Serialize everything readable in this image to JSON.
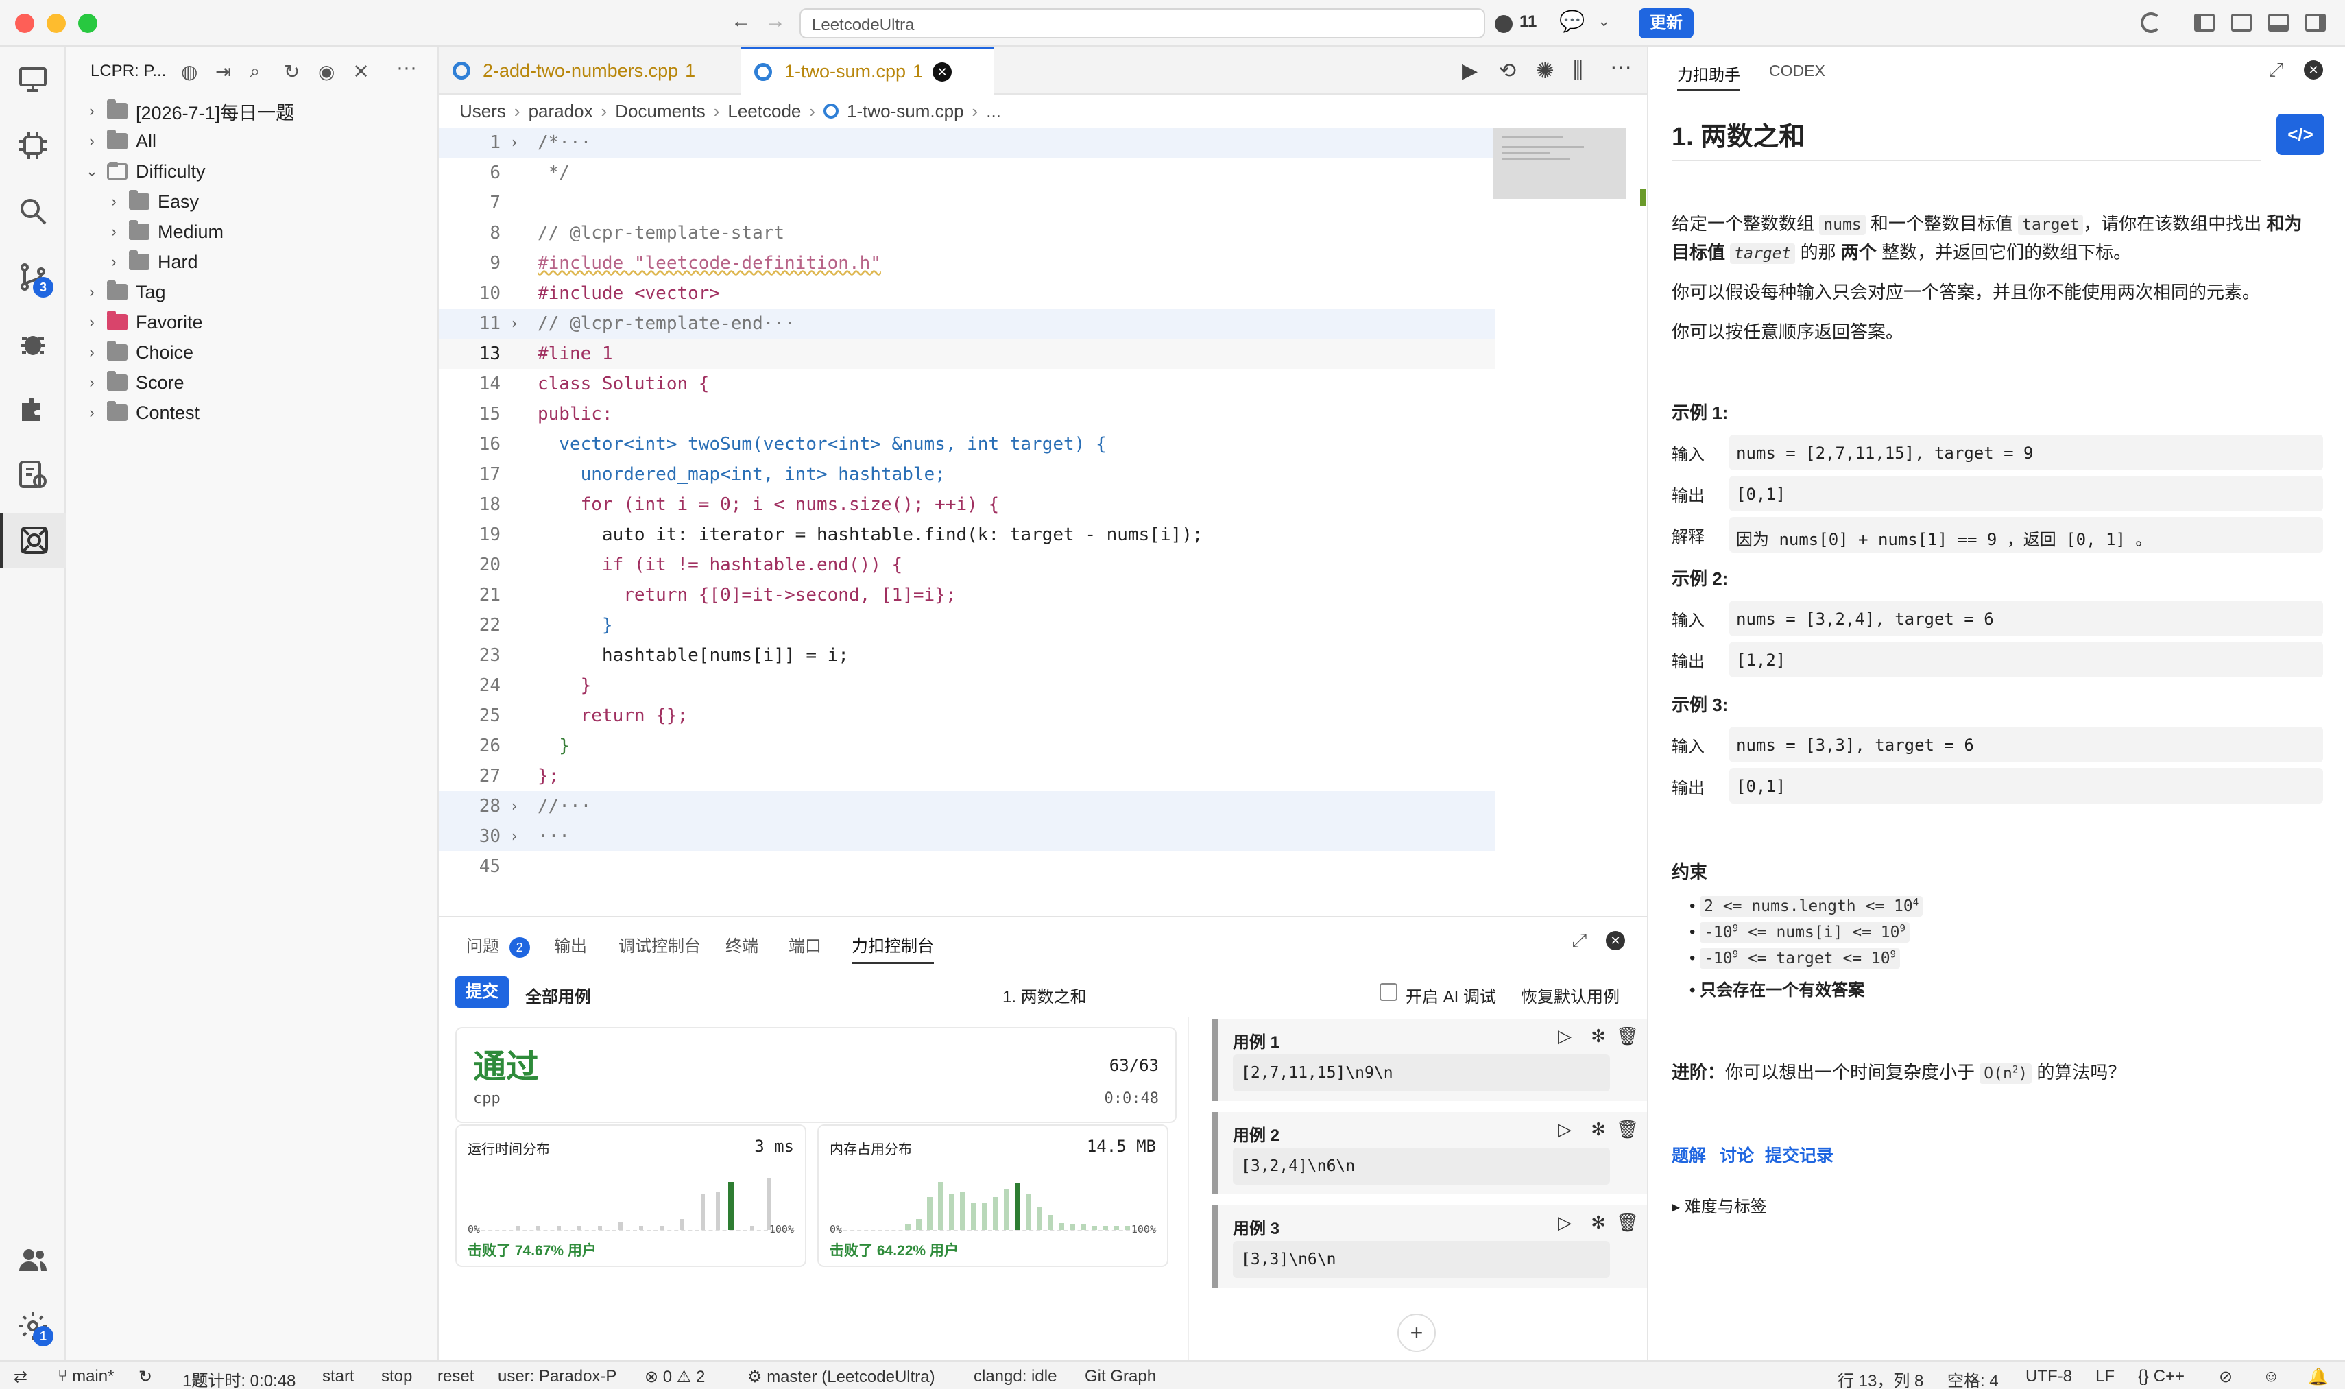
{
  "titlebar": {
    "search_text": "LeetcodeUltra",
    "pr_count": "11",
    "update_label": "更新"
  },
  "activity": {
    "source_badge": "3",
    "settings_badge": "1"
  },
  "explorer": {
    "title": "LCPR: P...",
    "items": [
      {
        "label": "[2026-7-1]每日一题"
      },
      {
        "label": "All"
      },
      {
        "label": "Difficulty"
      },
      {
        "label": "Easy"
      },
      {
        "label": "Medium"
      },
      {
        "label": "Hard"
      },
      {
        "label": "Tag"
      },
      {
        "label": "Favorite"
      },
      {
        "label": "Choice"
      },
      {
        "label": "Score"
      },
      {
        "label": "Contest"
      }
    ]
  },
  "editor": {
    "tabs": [
      {
        "label": "2-add-two-numbers.cpp",
        "badge": "1"
      },
      {
        "label": "1-two-sum.cpp",
        "badge": "1"
      }
    ],
    "breadcrumb": [
      "Users",
      "paradox",
      "Documents",
      "Leetcode",
      "1-two-sum.cpp",
      "..."
    ],
    "lines": [
      {
        "n": "1",
        "t": "/*···"
      },
      {
        "n": "6",
        "t": " */"
      },
      {
        "n": "7",
        "t": ""
      },
      {
        "n": "8",
        "t": "// @lcpr-template-start"
      },
      {
        "n": "9",
        "t": "#include \"leetcode-definition.h\""
      },
      {
        "n": "10",
        "t": "#include <vector>"
      },
      {
        "n": "11",
        "t": "// @lcpr-template-end···"
      },
      {
        "n": "13",
        "t": "#line 1"
      },
      {
        "n": "14",
        "t": "class Solution {"
      },
      {
        "n": "15",
        "t": "public:"
      },
      {
        "n": "16",
        "t": "  vector<int> twoSum(vector<int> &nums, int target) {"
      },
      {
        "n": "17",
        "t": "    unordered_map<int, int> hashtable;"
      },
      {
        "n": "18",
        "t": "    for (int i = 0; i < nums.size(); ++i) {"
      },
      {
        "n": "19",
        "t": "      auto it: iterator = hashtable.find(k: target - nums[i]);"
      },
      {
        "n": "20",
        "t": "      if (it != hashtable.end()) {"
      },
      {
        "n": "21",
        "t": "        return {[0]=it->second, [1]=i};"
      },
      {
        "n": "22",
        "t": "      }"
      },
      {
        "n": "23",
        "t": "      hashtable[nums[i]] = i;"
      },
      {
        "n": "24",
        "t": "    }"
      },
      {
        "n": "25",
        "t": "    return {};"
      },
      {
        "n": "26",
        "t": "  }"
      },
      {
        "n": "27",
        "t": "};"
      },
      {
        "n": "28",
        "t": "//···"
      },
      {
        "n": "30",
        "t": "···"
      },
      {
        "n": "45",
        "t": ""
      }
    ]
  },
  "panel": {
    "tabs": [
      "问题",
      "输出",
      "调试控制台",
      "终端",
      "端口",
      "力扣控制台"
    ],
    "problems_badge": "2",
    "submit_label": "提交",
    "all_cases_label": "全部用例",
    "problem_title": "1. 两数之和",
    "ai_debug_label": "开启 AI 调试",
    "restore_label": "恢复默认用例",
    "result": {
      "status": "通过",
      "lang": "cpp",
      "passed": "63/63",
      "time": "0:0:48"
    },
    "runtime": {
      "title": "运行时间分布",
      "value": "3 ms",
      "min": "0%",
      "max": "100%",
      "beat": "击败了 74.67% 用户"
    },
    "memory": {
      "title": "内存占用分布",
      "value": "14.5 MB",
      "min": "0%",
      "max": "100%",
      "beat": "击败了 64.22% 用户"
    },
    "cases": [
      {
        "title": "用例 1",
        "input": "[2,7,11,15]\\n9\\n"
      },
      {
        "title": "用例 2",
        "input": "[3,2,4]\\n6\\n"
      },
      {
        "title": "用例 3",
        "input": "[3,3]\\n6\\n"
      }
    ]
  },
  "right": {
    "tabs": [
      "力扣助手",
      "CODEX"
    ],
    "title": "1. 两数之和",
    "desc1_a": "给定一个整数数组",
    "desc1_nums": "nums",
    "desc1_b": "和一个整数目标值",
    "desc1_target": "target",
    "desc1_c": "，请你在该数组中找出",
    "desc1_d": "和为",
    "desc1_e": "目标值",
    "desc1_f": "target",
    "desc1_g": "的那",
    "desc1_h": "两个",
    "desc1_i": "整数，并返回它们的数组下标。",
    "desc2": "你可以假设每种输入只会对应一个答案，并且你不能使用两次相同的元素。",
    "desc3": "你可以按任意顺序返回答案。",
    "examples": [
      {
        "title": "示例 1:",
        "rows": [
          [
            "输入",
            "nums = [2,7,11,15], target = 9"
          ],
          [
            "输出",
            "[0,1]"
          ],
          [
            "解释",
            "因为 nums[0] + nums[1] == 9 ，返回 [0, 1] 。"
          ]
        ]
      },
      {
        "title": "示例 2:",
        "rows": [
          [
            "输入",
            "nums = [3,2,4], target = 6"
          ],
          [
            "输出",
            "[1,2]"
          ]
        ]
      },
      {
        "title": "示例 3:",
        "rows": [
          [
            "输入",
            "nums = [3,3], target = 6"
          ],
          [
            "输出",
            "[0,1]"
          ]
        ]
      }
    ],
    "constraints_title": "约束",
    "constraints": [
      "2 <= nums.length <= 10",
      "-10 <= nums[i] <= 10",
      "-10 <= target <= 10"
    ],
    "constraint_sups": [
      "4",
      "9",
      "9",
      "9",
      "9"
    ],
    "constraint_last": "只会存在一个有效答案",
    "advance_label": "进阶：",
    "advance_text": "你可以想出一个时间复杂度小于",
    "advance_code": "O(n",
    "advance_code_sup": "2",
    "advance_code_end": ")",
    "advance_end": "的算法吗？",
    "links": [
      "题解",
      "讨论",
      "提交记录"
    ],
    "tags_label": "难度与标签"
  },
  "status": {
    "branch": "main*",
    "timer": "1题计时: 0:0:48",
    "start": "start",
    "stop": "stop",
    "reset": "reset",
    "user": "user: Paradox-P",
    "errors": "0",
    "warnings": "2",
    "master": "master (LeetcodeUltra)",
    "clangd": "clangd: idle",
    "gitgraph": "Git Graph",
    "position": "行 13，列 8",
    "spaces": "空格: 4",
    "encoding": "UTF-8",
    "eol": "LF",
    "language": "C++"
  },
  "colors": {
    "accent": "#1f66e0",
    "pass": "#2e8b3a",
    "chart_highlight": "#2e7d32"
  }
}
